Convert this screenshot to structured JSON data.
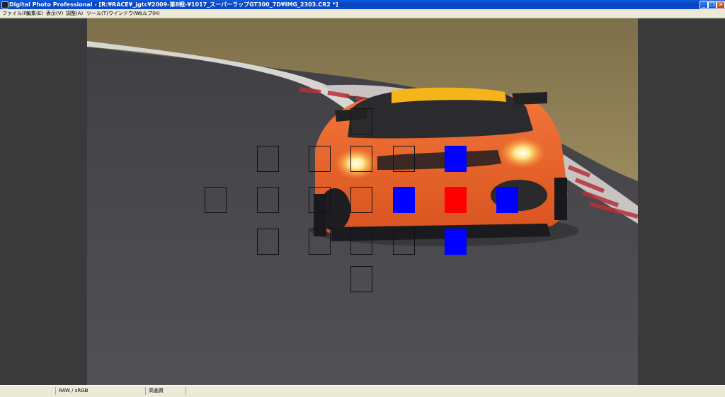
{
  "window": {
    "title": "Digital Photo Professional - [R:¥RACE¥_jgtc¥2009-第8戦-¥1017_スーパーラップGT300_7D¥IMG_2303.CR2 *]",
    "buttons": {
      "minimize": "_",
      "restore": "❐",
      "close": "✕"
    }
  },
  "menu": {
    "items": [
      "ファイル(F)",
      "編集(E)",
      "表示(V)",
      "調整(A)",
      "ツール(T)",
      "ウインドウ(W)",
      "ヘルプ(H)"
    ]
  },
  "status": {
    "color_mode": "RAW / sRGB",
    "quality": "高画質"
  },
  "af_points": {
    "colors": {
      "active_blue": "#0000ff",
      "selected_red": "#ff0000",
      "inactive": "#111111"
    }
  },
  "photo": {
    "accent_body": "#f0702a",
    "track": "#4a4a4d",
    "grass": "#8a7a50"
  }
}
